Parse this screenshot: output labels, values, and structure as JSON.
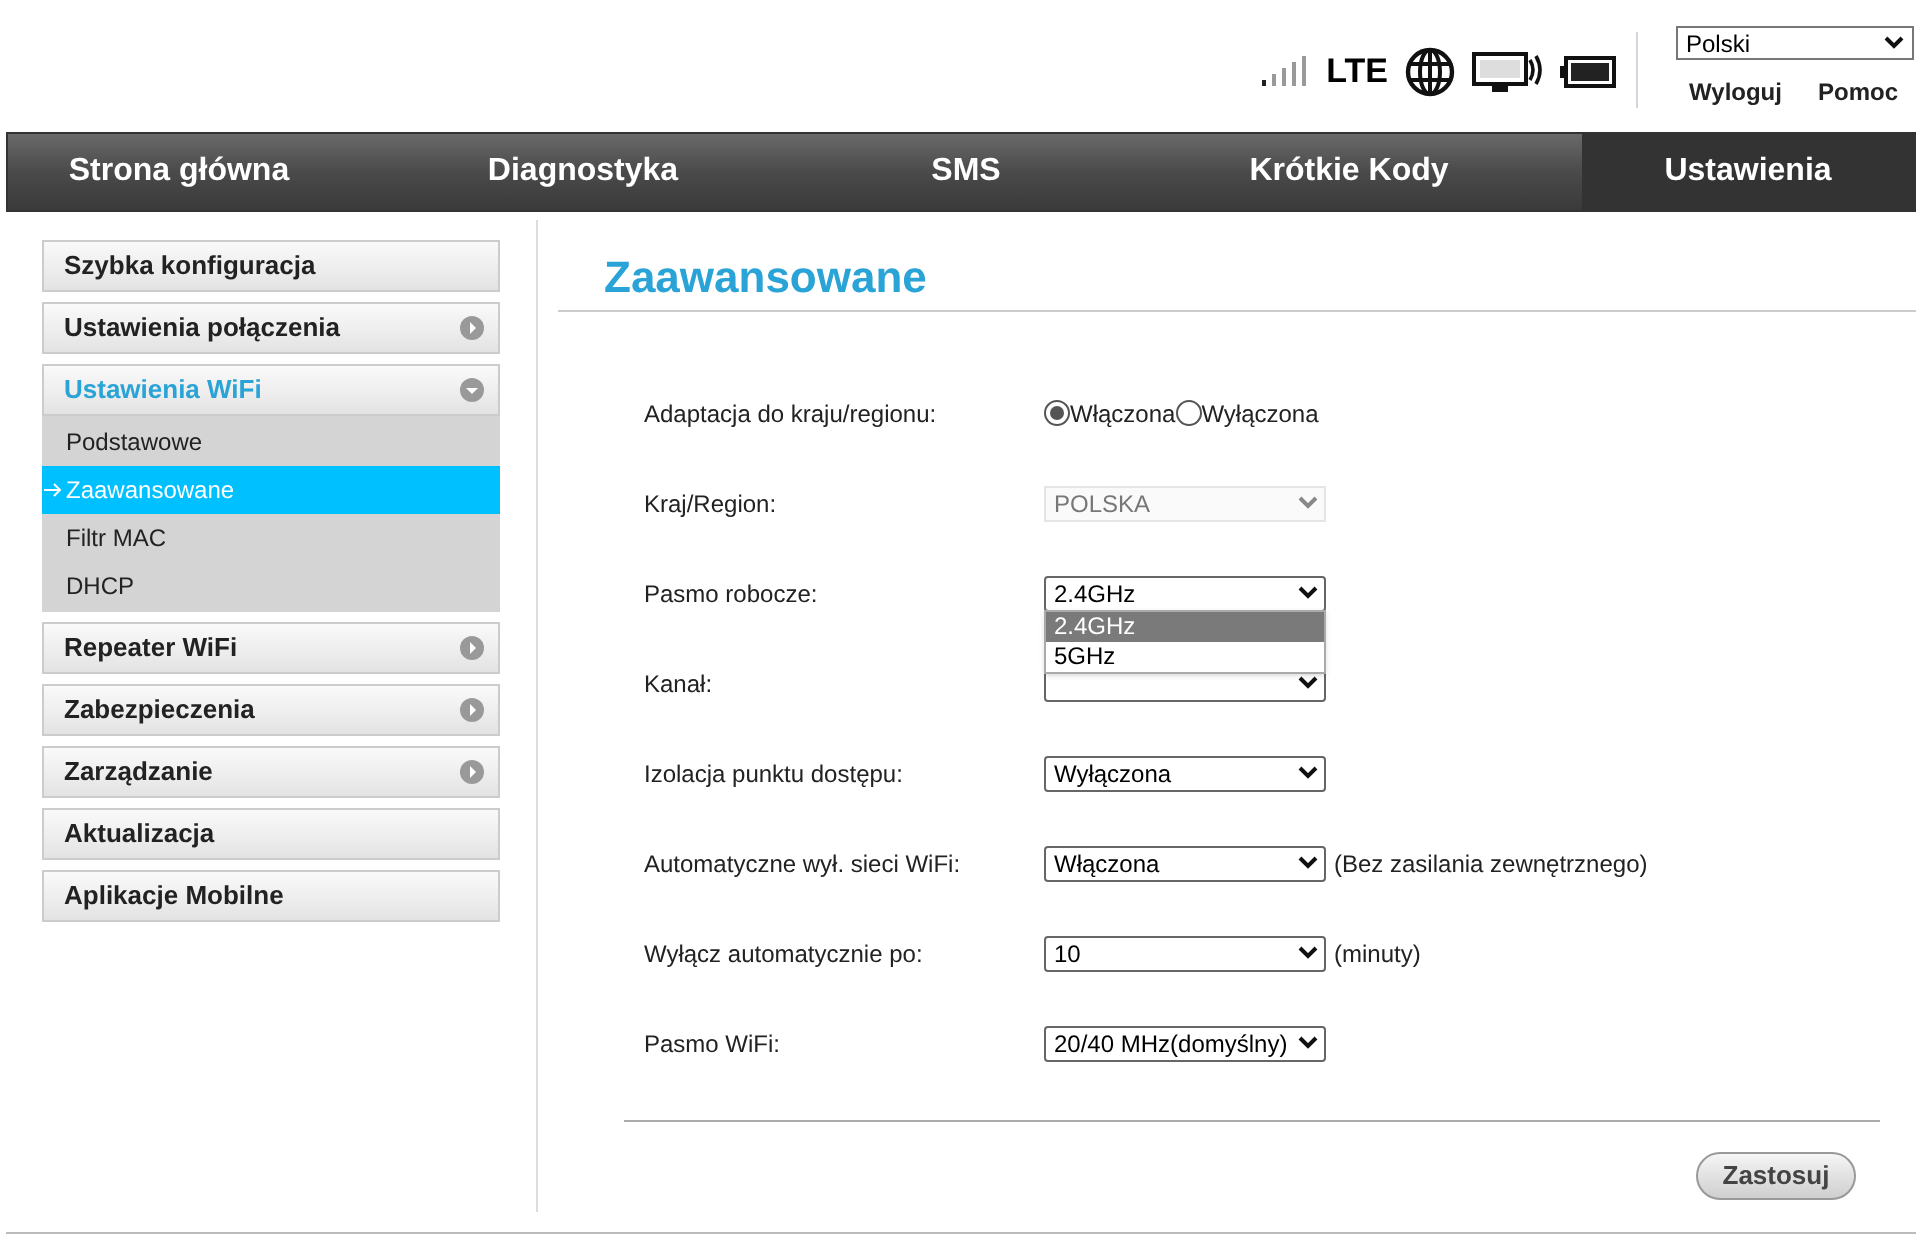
{
  "header": {
    "network": "LTE",
    "language": "Polski",
    "links": [
      "Wyloguj",
      "Pomoc"
    ]
  },
  "nav": [
    {
      "label": "Strona główna",
      "selected": false
    },
    {
      "label": "Diagnostyka",
      "selected": false
    },
    {
      "label": "SMS",
      "selected": false
    },
    {
      "label": "Krótkie Kody",
      "selected": false
    },
    {
      "label": "Ustawienia",
      "selected": true
    }
  ],
  "sidebar": [
    {
      "label": "Szybka konfiguracja",
      "kind": "plain",
      "expanded": false
    },
    {
      "label": "Ustawienia połączenia",
      "kind": "group",
      "expanded": false
    },
    {
      "label": "Ustawienia WiFi",
      "kind": "group",
      "expanded": true,
      "children": [
        {
          "label": "Podstawowe",
          "selected": false
        },
        {
          "label": "Zaawansowane",
          "selected": true
        },
        {
          "label": "Filtr MAC",
          "selected": false
        },
        {
          "label": "DHCP",
          "selected": false
        }
      ]
    },
    {
      "label": "Repeater WiFi",
      "kind": "group",
      "expanded": false
    },
    {
      "label": "Zabezpieczenia",
      "kind": "group",
      "expanded": false
    },
    {
      "label": "Zarządzanie",
      "kind": "group",
      "expanded": false
    },
    {
      "label": "Aktualizacja",
      "kind": "plain",
      "expanded": false
    },
    {
      "label": "Aplikacje Mobilne",
      "kind": "plain",
      "expanded": false
    }
  ],
  "title": "Zaawansowane",
  "form": [
    {
      "label": "Adaptacja do kraju/regionu:",
      "kind": "radio",
      "options": [
        {
          "label": "Włączona",
          "selected": true
        },
        {
          "label": "Wyłączona",
          "selected": false
        }
      ]
    },
    {
      "label": "Kraj/Region:",
      "kind": "select",
      "value": "POLSKA",
      "disabled": true
    },
    {
      "label": "Pasmo robocze:",
      "kind": "select",
      "value": "2.4GHz",
      "disabled": false,
      "open_options": [
        {
          "label": "2.4GHz",
          "selected": true
        },
        {
          "label": "5GHz",
          "selected": false
        }
      ]
    },
    {
      "label": "Kanał:",
      "kind": "select",
      "disabled": false
    },
    {
      "label": "Izolacja punktu dostępu:",
      "kind": "select",
      "value": "Wyłączona",
      "disabled": false
    },
    {
      "label": "Automatyczne wył. sieci WiFi:",
      "kind": "select",
      "value": "Włączona",
      "disabled": false,
      "note": "(Bez zasilania zewnętrznego)"
    },
    {
      "label": "Wyłącz automatycznie po:",
      "kind": "select",
      "value": "10",
      "disabled": false,
      "note": "(minuty)"
    },
    {
      "label": "Pasmo WiFi:",
      "kind": "select",
      "value": "20/40 MHz(domyślny)",
      "disabled": false
    }
  ],
  "apply_button": "Zastosuj"
}
